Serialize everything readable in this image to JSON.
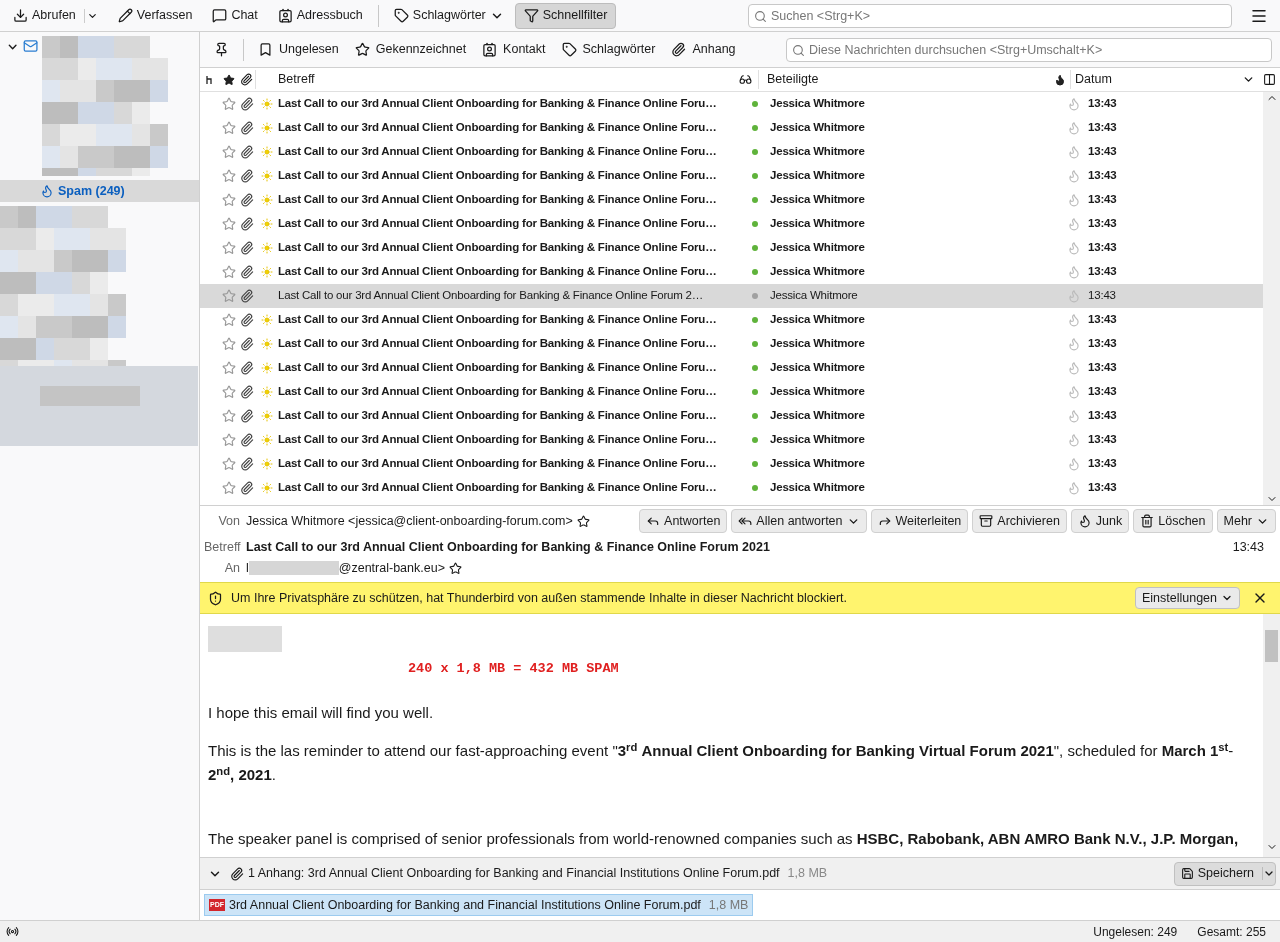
{
  "toolbar": {
    "buttons": [
      {
        "label": "Abrufen",
        "kind": "get",
        "menu": true,
        "pressed": false
      },
      {
        "label": "Verfassen",
        "kind": "write",
        "menu": false,
        "pressed": false
      },
      {
        "label": "Chat",
        "kind": "chat",
        "menu": false,
        "pressed": false
      },
      {
        "label": "Adressbuch",
        "kind": "contacts",
        "menu": false,
        "pressed": false
      },
      {
        "label": "Schlagwörter",
        "kind": "tag",
        "menu": true,
        "pressed": false
      },
      {
        "label": "Schnellfilter",
        "kind": "filter",
        "menu": false,
        "pressed": true
      }
    ],
    "search": {
      "placeholder": "Suchen <Strg+K>"
    }
  },
  "folder_pane": {
    "items": [
      {
        "label": "Spam (249)",
        "selected": true
      }
    ]
  },
  "quick_filter": {
    "buttons": [
      {
        "label": "Ungelesen",
        "kind": "bookmark"
      },
      {
        "label": "Gekennzeichnet",
        "kind": "star"
      },
      {
        "label": "Kontakt",
        "kind": "contacts"
      },
      {
        "label": "Schlagwörter",
        "kind": "tag"
      },
      {
        "label": "Anhang",
        "kind": "attachment"
      }
    ],
    "search": {
      "placeholder": "Diese Nachrichten durchsuchen <Strg+Umschalt+K>"
    }
  },
  "table": {
    "columns": [
      "Betreff",
      "Beteiligte",
      "Datum"
    ],
    "rows": [
      {
        "subject": "Last Call to our 3rd Annual Client Onboarding for Banking & Finance Online Foru…",
        "correspondent": "Jessica Whitmore",
        "date": "13:43",
        "unread": true,
        "selected": false
      },
      {
        "subject": "Last Call to our 3rd Annual Client Onboarding for Banking & Finance Online Foru…",
        "correspondent": "Jessica Whitmore",
        "date": "13:43",
        "unread": true,
        "selected": false
      },
      {
        "subject": "Last Call to our 3rd Annual Client Onboarding for Banking & Finance Online Foru…",
        "correspondent": "Jessica Whitmore",
        "date": "13:43",
        "unread": true,
        "selected": false
      },
      {
        "subject": "Last Call to our 3rd Annual Client Onboarding for Banking & Finance Online Foru…",
        "correspondent": "Jessica Whitmore",
        "date": "13:43",
        "unread": true,
        "selected": false
      },
      {
        "subject": "Last Call to our 3rd Annual Client Onboarding for Banking & Finance Online Foru…",
        "correspondent": "Jessica Whitmore",
        "date": "13:43",
        "unread": true,
        "selected": false
      },
      {
        "subject": "Last Call to our 3rd Annual Client Onboarding for Banking & Finance Online Foru…",
        "correspondent": "Jessica Whitmore",
        "date": "13:43",
        "unread": true,
        "selected": false
      },
      {
        "subject": "Last Call to our 3rd Annual Client Onboarding for Banking & Finance Online Foru…",
        "correspondent": "Jessica Whitmore",
        "date": "13:43",
        "unread": true,
        "selected": false
      },
      {
        "subject": "Last Call to our 3rd Annual Client Onboarding for Banking & Finance Online Foru…",
        "correspondent": "Jessica Whitmore",
        "date": "13:43",
        "unread": true,
        "selected": false
      },
      {
        "subject": "Last Call to our 3rd Annual Client Onboarding for Banking & Finance Online Forum 2…",
        "correspondent": "Jessica Whitmore",
        "date": "13:43",
        "unread": false,
        "selected": true
      },
      {
        "subject": "Last Call to our 3rd Annual Client Onboarding for Banking & Finance Online Foru…",
        "correspondent": "Jessica Whitmore",
        "date": "13:43",
        "unread": true,
        "selected": false
      },
      {
        "subject": "Last Call to our 3rd Annual Client Onboarding for Banking & Finance Online Foru…",
        "correspondent": "Jessica Whitmore",
        "date": "13:43",
        "unread": true,
        "selected": false
      },
      {
        "subject": "Last Call to our 3rd Annual Client Onboarding for Banking & Finance Online Foru…",
        "correspondent": "Jessica Whitmore",
        "date": "13:43",
        "unread": true,
        "selected": false
      },
      {
        "subject": "Last Call to our 3rd Annual Client Onboarding for Banking & Finance Online Foru…",
        "correspondent": "Jessica Whitmore",
        "date": "13:43",
        "unread": true,
        "selected": false
      },
      {
        "subject": "Last Call to our 3rd Annual Client Onboarding for Banking & Finance Online Foru…",
        "correspondent": "Jessica Whitmore",
        "date": "13:43",
        "unread": true,
        "selected": false
      },
      {
        "subject": "Last Call to our 3rd Annual Client Onboarding for Banking & Finance Online Foru…",
        "correspondent": "Jessica Whitmore",
        "date": "13:43",
        "unread": true,
        "selected": false
      },
      {
        "subject": "Last Call to our 3rd Annual Client Onboarding for Banking & Finance Online Foru…",
        "correspondent": "Jessica Whitmore",
        "date": "13:43",
        "unread": true,
        "selected": false
      },
      {
        "subject": "Last Call to our 3rd Annual Client Onboarding for Banking & Finance Online Foru…",
        "correspondent": "Jessica Whitmore",
        "date": "13:43",
        "unread": true,
        "selected": false
      }
    ]
  },
  "message_header": {
    "from_label": "Von",
    "from": "Jessica Whitmore <jessica@client-onboarding-forum.com>",
    "subject_label": "Betreff",
    "subject": "Last Call to our 3rd Annual Client Onboarding for Banking & Finance Online Forum 2021",
    "time": "13:43",
    "to_label": "An",
    "to_prefix": "l",
    "to": "@zentral-bank.eu>",
    "actions": [
      {
        "label": "Antworten",
        "kind": "reply",
        "menu": false
      },
      {
        "label": "Allen antworten",
        "kind": "reply-all",
        "menu": true
      },
      {
        "label": "Weiterleiten",
        "kind": "forward",
        "menu": false
      },
      {
        "label": "Archivieren",
        "kind": "archive",
        "menu": false
      },
      {
        "label": "Junk",
        "kind": "junk",
        "menu": false
      },
      {
        "label": "Löschen",
        "kind": "delete",
        "menu": false
      },
      {
        "label": "Mehr",
        "kind": "more",
        "menu": true
      }
    ]
  },
  "notification": {
    "text": "Um Ihre Privatsphäre zu schützen, hat Thunderbird von außen stammende Inhalte in dieser Nachricht blockiert.",
    "button": "Einstellungen"
  },
  "body": {
    "heading": "240 x 1,8 MB = 432 MB SPAM",
    "paragraphs": [
      "I hope this email will find you well.",
      "This is the las reminder to attend our fast-approaching event \"**3**$^{rd}$ **Annual Client Onboarding for Banking Virtual Forum 2021**\", scheduled for **March 1**$^{st}$-**2**$^{nd}$**, 2021**.",
      "The speaker panel is comprised of senior professionals from world-renowned companies such as **HSBC, Rabobank, ABN AMRO Bank N.V., J.P. Morgan,**"
    ]
  },
  "attachments": {
    "summary": "1 Anhang: 3rd Annual Client Onboarding for Banking and Financial Institutions Online Forum.pdf",
    "size": "1,8 MB",
    "save": "Speichern",
    "items": [
      {
        "name": "3rd Annual Client Onboarding for Banking and Financial Institutions Online Forum.pdf",
        "size": "1,8 MB",
        "badge": "PDF"
      }
    ]
  },
  "status_bar": {
    "unread": "Ungelesen: 249",
    "total": "Gesamt: 255"
  }
}
